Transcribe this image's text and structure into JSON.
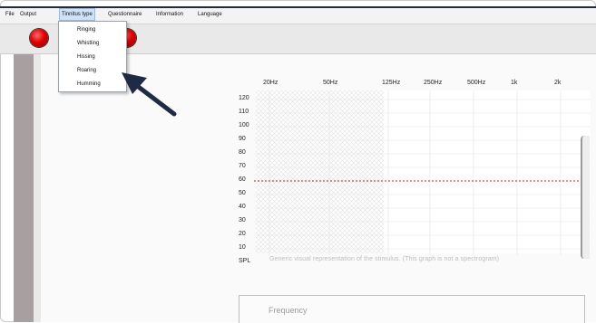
{
  "menu": [
    "File",
    "Output",
    "Tinnitus type",
    "Questionnaire",
    "Information",
    "Language"
  ],
  "tinnitus_menu": [
    "Ringing",
    "Whistling",
    "Hissing",
    "Roaring",
    "Humming"
  ],
  "chart": {
    "frequency_labels": [
      "20Hz",
      "50Hz",
      "125Hz",
      "250Hz",
      "500Hz",
      "1k",
      "2k"
    ],
    "spl_labels": [
      "120",
      "110",
      "100",
      "90",
      "80",
      "70",
      "60",
      "50",
      "40",
      "30",
      "20",
      "10"
    ],
    "axis_unit": "SPL",
    "caption": "Generic visual representation of the stimulus. (This graph is not a spectrogram)",
    "dashed_line_level": 60
  },
  "panel": {
    "frequency_title": "Frequency"
  },
  "colors": {
    "accent_dark": "#1f2b46",
    "record_red": "#e00000",
    "dashed_red": "#b3261e"
  }
}
